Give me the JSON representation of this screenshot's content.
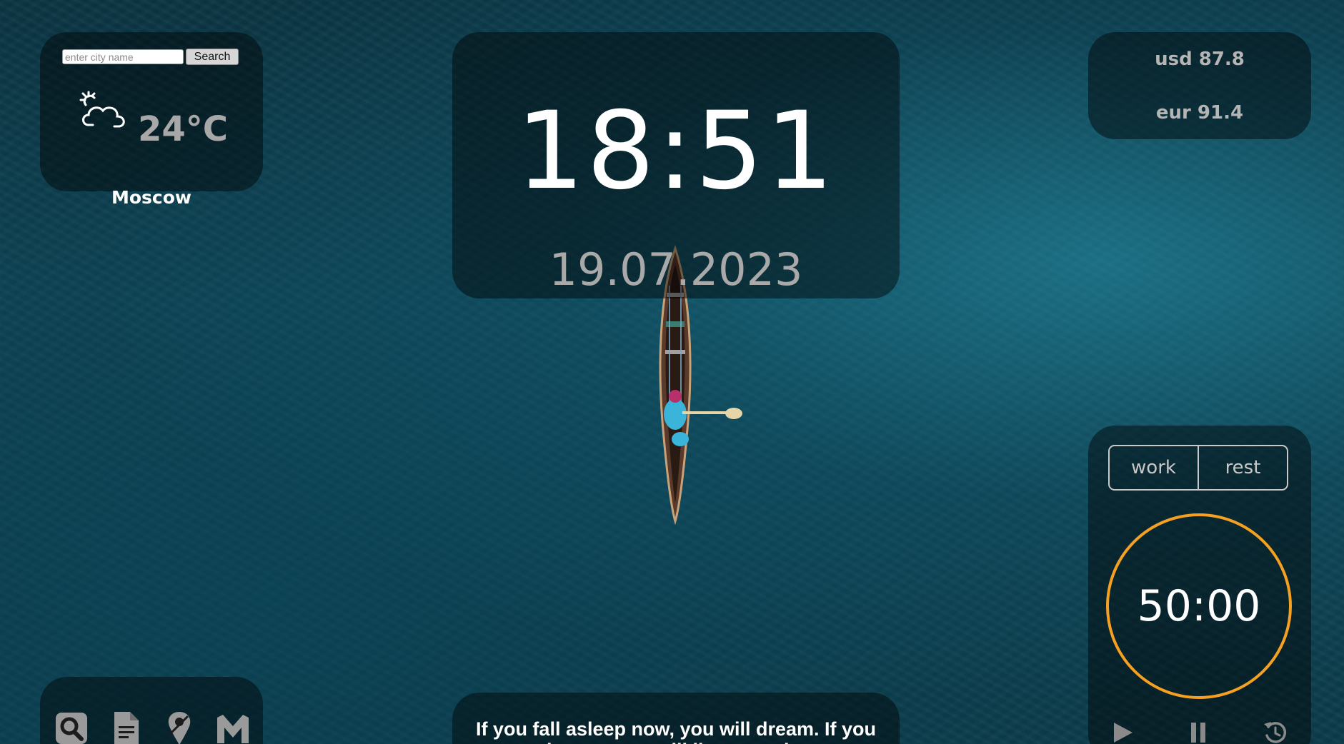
{
  "weather": {
    "search_placeholder": "enter city name",
    "search_button": "Search",
    "icon": "partly-cloudy-icon",
    "temperature": "24°C",
    "city": "Moscow"
  },
  "clock": {
    "time": "18:51",
    "date": "19.07.2023"
  },
  "currency": {
    "usd": "usd 87.8",
    "eur": "eur 91.4"
  },
  "pomodoro": {
    "tabs": [
      "work",
      "rest"
    ],
    "timer": "50:00",
    "accent_color": "#f5a021",
    "controls": [
      "play-icon",
      "pause-icon",
      "reset-icon"
    ]
  },
  "apps": {
    "icons": [
      "search-icon",
      "document-icon",
      "maps-icon",
      "mail-icon"
    ]
  },
  "quote": {
    "text": "If you fall asleep now, you will dream. If you study now, you will live your dream."
  }
}
